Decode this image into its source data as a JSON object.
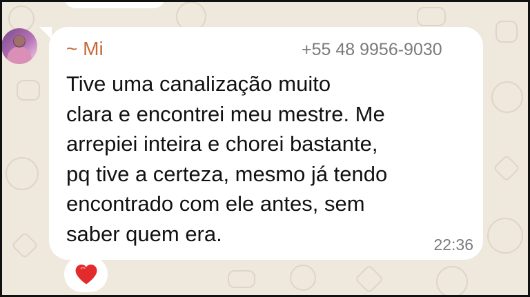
{
  "message": {
    "sender_name": "~ Mi",
    "sender_phone": "+55 48 9956-9030",
    "text_lines": [
      "Tive uma canalização muito",
      "clara e encontrei meu mestre. Me",
      "arrepiei inteira e chorei bastante,",
      "pq tive a certeza, mesmo já tendo",
      "encontrado com ele antes, sem",
      "saber quem era."
    ],
    "time": "22:36"
  },
  "reaction": {
    "emoji_name": "heart-icon",
    "color": "#e32b2b"
  },
  "colors": {
    "background": "#efe8dd",
    "bubble": "#ffffff",
    "sender_name": "#c76a3a",
    "meta_text": "#7a7a7a",
    "message_text": "#111111"
  }
}
